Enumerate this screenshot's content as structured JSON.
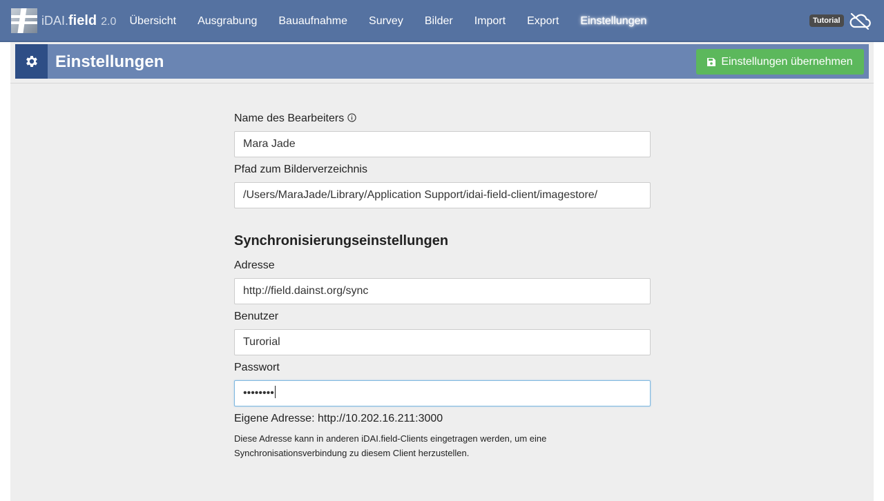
{
  "app": {
    "name_prefix": "iDAI.",
    "name_main": "field",
    "version": "2.0"
  },
  "nav": {
    "items": [
      {
        "label": "Übersicht"
      },
      {
        "label": "Ausgrabung"
      },
      {
        "label": "Bauaufnahme"
      },
      {
        "label": "Survey"
      },
      {
        "label": "Bilder"
      },
      {
        "label": "Import"
      },
      {
        "label": "Export"
      },
      {
        "label": "Einstellungen",
        "active": true
      }
    ],
    "project_badge": "Tutorial",
    "sync_status_icon": "cloud-off-icon"
  },
  "header": {
    "icon": "gear-icon",
    "title": "Einstellungen",
    "apply_button_label": "Einstellungen übernehmen",
    "apply_button_icon": "save-icon"
  },
  "form": {
    "editor_name": {
      "label": "Name des Bearbeiters",
      "value": "Mara Jade",
      "info_icon": "info-icon"
    },
    "image_path": {
      "label": "Pfad zum Bilderverzeichnis",
      "value": "/Users/MaraJade/Library/Application Support/idai-field-client/imagestore/"
    },
    "sync_heading": "Synchronisierungseinstellungen",
    "address": {
      "label": "Adresse",
      "value": "http://field.dainst.org/sync"
    },
    "user": {
      "label": "Benutzer",
      "value": "Turorial"
    },
    "password": {
      "label": "Passwort",
      "value": "••••••••"
    },
    "own_address": "Eigene Adresse: http://10.202.16.211:3000",
    "own_address_note_line1": "Diese Adresse kann in anderen iDAI.field-Clients eingetragen werden, um eine",
    "own_address_note_line2": "Synchronisationsverbindung zu diesem Client herzustellen."
  },
  "colors": {
    "navbar": "#5572a1",
    "header_bar": "#6a85b3",
    "header_icon_box": "#2e4e86",
    "apply_button": "#5cb85c",
    "page_background": "#eeeeee"
  }
}
